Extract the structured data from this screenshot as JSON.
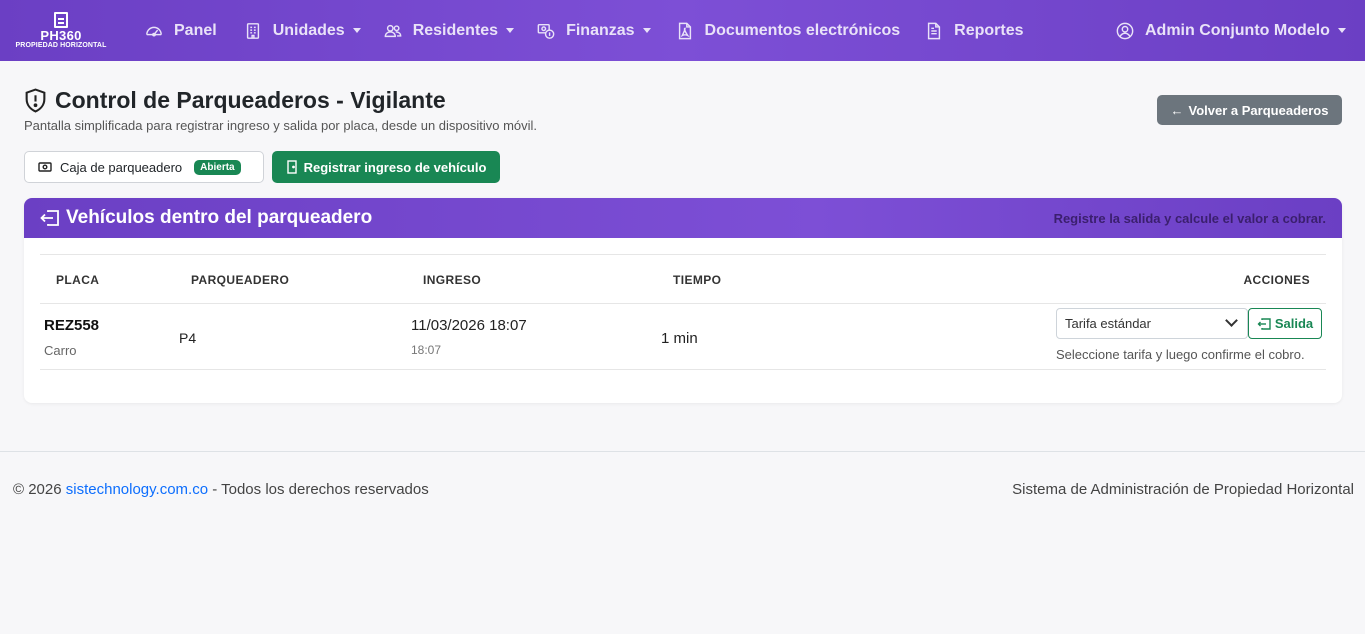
{
  "nav": {
    "brand_name": "PH360",
    "brand_sub": "PROPIEDAD HORIZONTAL",
    "items": [
      {
        "label": "Panel",
        "icon": "speedometer-icon",
        "has_caret": false
      },
      {
        "label": "Unidades",
        "icon": "building-icon",
        "has_caret": true
      },
      {
        "label": "Residentes",
        "icon": "people-icon",
        "has_caret": true
      },
      {
        "label": "Finanzas",
        "icon": "cash-coin-icon",
        "has_caret": true
      },
      {
        "label": "Documentos electrónicos",
        "icon": "file-pdf-icon",
        "has_caret": false
      },
      {
        "label": "Reportes",
        "icon": "file-text-icon",
        "has_caret": false
      }
    ],
    "user_label": "Admin Conjunto Modelo"
  },
  "page": {
    "title": "Control de Parqueaderos - Vigilante",
    "subtitle": "Pantalla simplificada para registrar ingreso y salida por placa, desde un dispositivo móvil.",
    "back_button": "Volver a Parqueaderos",
    "cash_box_label": "Caja de parqueadero",
    "cash_box_status": "Abierta",
    "register_button": "Registrar ingreso de vehículo"
  },
  "card": {
    "title": "Vehículos dentro del parqueadero",
    "hint": "Registre la salida y calcule el valor a cobrar.",
    "columns": [
      "PLACA",
      "PARQUEADERO",
      "INGRESO",
      "TIEMPO",
      "ACCIONES"
    ],
    "rows": [
      {
        "plate": "REZ558",
        "vehicle_type": "Carro",
        "slot": "P4",
        "entry_date": "11/03/2026 18:07",
        "entry_time": "18:07",
        "duration": "1 min",
        "rate": "Tarifa estándar",
        "exit_button": "Salida",
        "rate_hint": "Seleccione tarifa y luego confirme el cobro."
      }
    ]
  },
  "footer": {
    "copyright": "© 2026",
    "link": "sistechnology.com.co",
    "rights": "- Todos los derechos reservados",
    "right_text": "Sistema de Administración de Propiedad Horizontal"
  },
  "colors": {
    "primary_purple": "#7d4fd6",
    "success": "#198754",
    "secondary": "#6c757d"
  }
}
